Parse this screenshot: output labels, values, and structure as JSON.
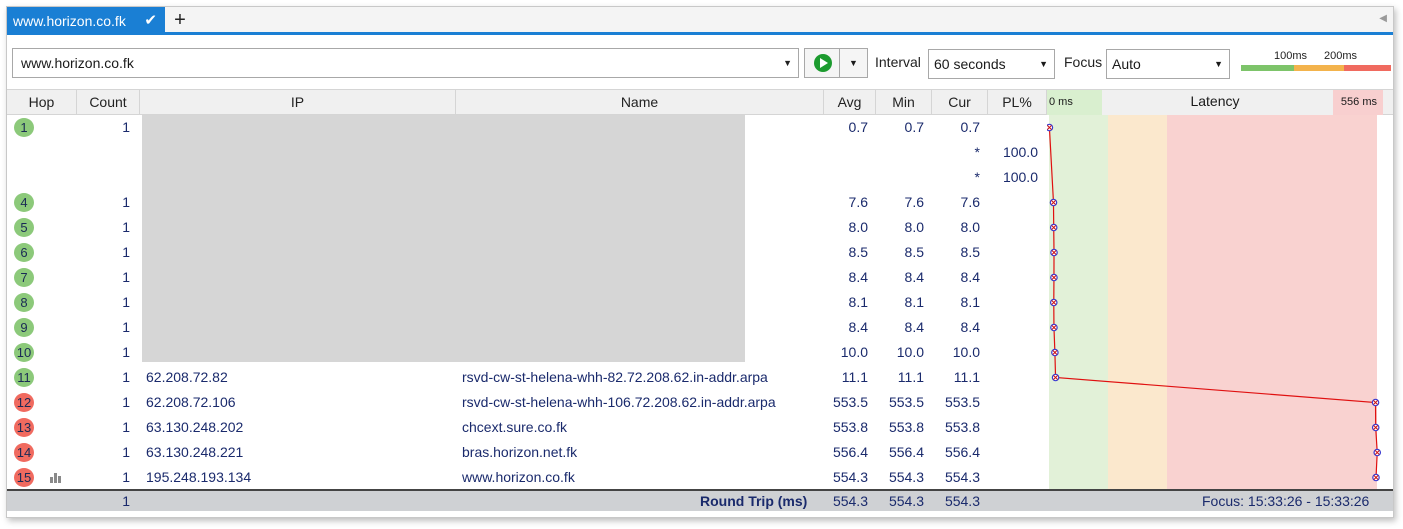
{
  "tab": {
    "title": "www.horizon.co.fk"
  },
  "toolbar": {
    "target": "www.horizon.co.fk",
    "interval_label": "Interval",
    "interval_value": "60 seconds",
    "focus_label": "Focus",
    "focus_value": "Auto",
    "scale_100": "100ms",
    "scale_200": "200ms"
  },
  "columns": [
    "Hop",
    "Count",
    "IP",
    "Name",
    "Avg",
    "Min",
    "Cur",
    "PL%"
  ],
  "latency": {
    "label": "Latency",
    "min": "0 ms",
    "max": "556 ms",
    "max_value": 556
  },
  "rows": [
    {
      "hop": "1",
      "status": "ok",
      "count": "1",
      "ip": "",
      "name": "",
      "avg": "0.7",
      "min": "0.7",
      "cur": "0.7",
      "pl": ""
    },
    {
      "hop": "",
      "status": "",
      "count": "",
      "ip": "",
      "name": "",
      "avg": "",
      "min": "",
      "cur": "*",
      "pl": "100.0"
    },
    {
      "hop": "",
      "status": "",
      "count": "",
      "ip": "",
      "name": "",
      "avg": "",
      "min": "",
      "cur": "*",
      "pl": "100.0"
    },
    {
      "hop": "4",
      "status": "ok",
      "count": "1",
      "ip": "",
      "name": "",
      "avg": "7.6",
      "min": "7.6",
      "cur": "7.6",
      "pl": ""
    },
    {
      "hop": "5",
      "status": "ok",
      "count": "1",
      "ip": "",
      "name": "",
      "avg": "8.0",
      "min": "8.0",
      "cur": "8.0",
      "pl": ""
    },
    {
      "hop": "6",
      "status": "ok",
      "count": "1",
      "ip": "",
      "name": "",
      "avg": "8.5",
      "min": "8.5",
      "cur": "8.5",
      "pl": ""
    },
    {
      "hop": "7",
      "status": "ok",
      "count": "1",
      "ip": "",
      "name": "",
      "avg": "8.4",
      "min": "8.4",
      "cur": "8.4",
      "pl": ""
    },
    {
      "hop": "8",
      "status": "ok",
      "count": "1",
      "ip": "",
      "name": "",
      "avg": "8.1",
      "min": "8.1",
      "cur": "8.1",
      "pl": ""
    },
    {
      "hop": "9",
      "status": "ok",
      "count": "1",
      "ip": "",
      "name": "",
      "avg": "8.4",
      "min": "8.4",
      "cur": "8.4",
      "pl": ""
    },
    {
      "hop": "10",
      "status": "ok",
      "count": "1",
      "ip": "",
      "name": "",
      "avg": "10.0",
      "min": "10.0",
      "cur": "10.0",
      "pl": ""
    },
    {
      "hop": "11",
      "status": "ok",
      "count": "1",
      "ip": "62.208.72.82",
      "name": "rsvd-cw-st-helena-whh-82.72.208.62.in-addr.arpa",
      "avg": "11.1",
      "min": "11.1",
      "cur": "11.1",
      "pl": ""
    },
    {
      "hop": "12",
      "status": "bad",
      "count": "1",
      "ip": "62.208.72.106",
      "name": "rsvd-cw-st-helena-whh-106.72.208.62.in-addr.arpa",
      "avg": "553.5",
      "min": "553.5",
      "cur": "553.5",
      "pl": ""
    },
    {
      "hop": "13",
      "status": "bad",
      "count": "1",
      "ip": "63.130.248.202",
      "name": "chcext.sure.co.fk",
      "avg": "553.8",
      "min": "553.8",
      "cur": "553.8",
      "pl": ""
    },
    {
      "hop": "14",
      "status": "bad",
      "count": "1",
      "ip": "63.130.248.221",
      "name": "bras.horizon.net.fk",
      "avg": "556.4",
      "min": "556.4",
      "cur": "556.4",
      "pl": ""
    },
    {
      "hop": "15",
      "status": "bad",
      "count": "1",
      "ip": "195.248.193.134",
      "name": "www.horizon.co.fk",
      "avg": "554.3",
      "min": "554.3",
      "cur": "554.3",
      "pl": ""
    }
  ],
  "footer": {
    "count": "1",
    "label": "Round Trip (ms)",
    "avg": "554.3",
    "min": "554.3",
    "cur": "554.3",
    "focus": "Focus: 15:33:26 - 15:33:26"
  },
  "colors": {
    "accent": "#1a7fd4",
    "ok": "#8cc97a",
    "bad": "#f06a5f",
    "zone_green": "#e2f1d8",
    "zone_yellow": "#fbe8cd",
    "zone_red": "#f9d2d0",
    "line": "#e01010"
  }
}
